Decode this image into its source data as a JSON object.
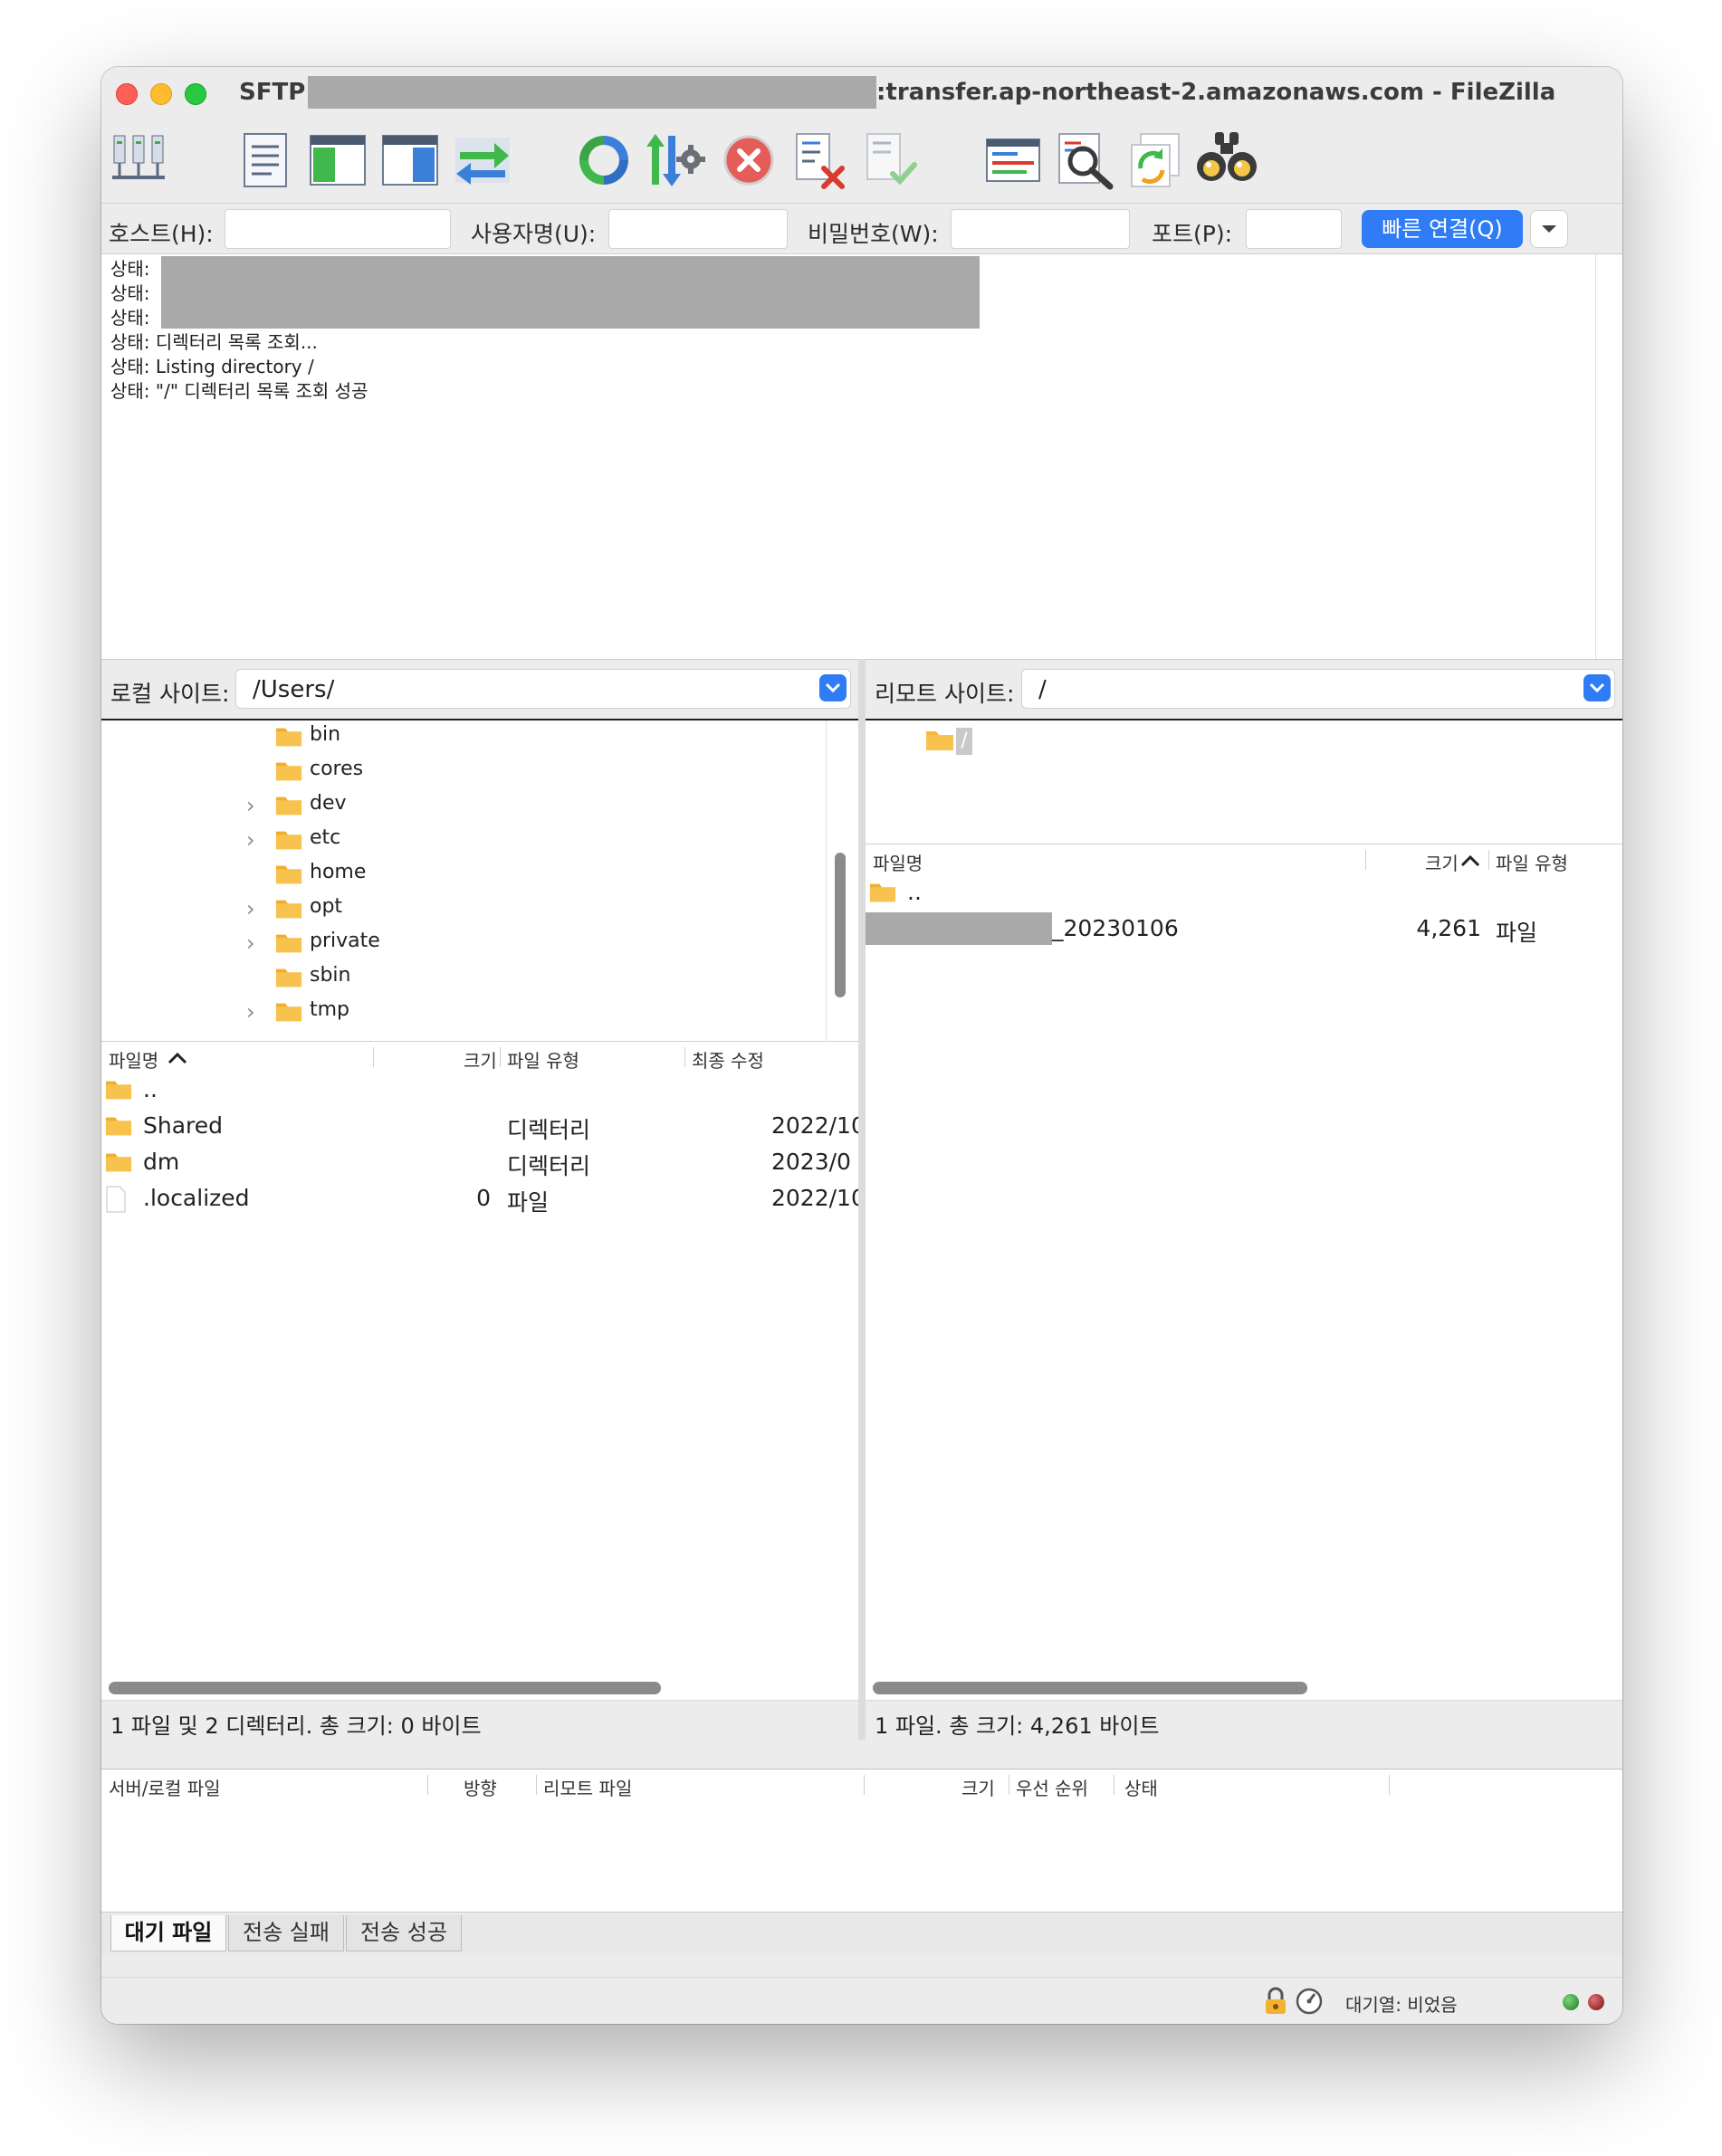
{
  "window": {
    "protocol": "SFTP",
    "host_title": ":transfer.ap-northeast-2.amazonaws.com - FileZilla"
  },
  "toolbar": {
    "buttons": [
      {
        "name": "site-manager-icon"
      },
      {
        "name": "message-log-toggle-icon"
      },
      {
        "name": "local-tree-toggle-icon"
      },
      {
        "name": "remote-tree-toggle-icon"
      },
      {
        "name": "transfer-queue-toggle-icon"
      },
      {
        "name": "refresh-icon"
      },
      {
        "name": "process-queue-icon"
      },
      {
        "name": "cancel-operation-icon"
      },
      {
        "name": "disconnect-icon"
      },
      {
        "name": "reconnect-icon"
      },
      {
        "name": "directory-filter-icon"
      },
      {
        "name": "directory-compare-icon"
      },
      {
        "name": "sync-browse-icon"
      },
      {
        "name": "search-files-icon"
      }
    ]
  },
  "quickconnect": {
    "host_label": "호스트(H):",
    "user_label": "사용자명(U):",
    "pass_label": "비밀번호(W):",
    "port_label": "포트(P):",
    "host_value": "",
    "user_value": "",
    "pass_value": "",
    "port_value": "",
    "connect_button": "빠른 연결(Q)"
  },
  "log": {
    "lines": [
      {
        "prefix": "상태:",
        "text": ""
      },
      {
        "prefix": "상태:",
        "text": ""
      },
      {
        "prefix": "상태:",
        "text": ""
      },
      {
        "prefix": "상태:",
        "text": "디렉터리 목록 조회..."
      },
      {
        "prefix": "상태:",
        "text": "Listing directory /"
      },
      {
        "prefix": "상태:",
        "text": "\"/\" 디렉터리 목록 조회 성공"
      }
    ]
  },
  "local": {
    "site_label": "로컬 사이트:",
    "path": "/Users/",
    "tree": [
      {
        "name": "bin",
        "expandable": false
      },
      {
        "name": "cores",
        "expandable": false
      },
      {
        "name": "dev",
        "expandable": true
      },
      {
        "name": "etc",
        "expandable": true
      },
      {
        "name": "home",
        "expandable": false
      },
      {
        "name": "opt",
        "expandable": true
      },
      {
        "name": "private",
        "expandable": true
      },
      {
        "name": "sbin",
        "expandable": false
      },
      {
        "name": "tmp",
        "expandable": true
      }
    ],
    "columns": {
      "name": "파일명",
      "size": "크기",
      "type": "파일 유형",
      "modified": "최종 수정"
    },
    "files": [
      {
        "name": "..",
        "size": "",
        "type": "",
        "modified": "",
        "kind": "folder"
      },
      {
        "name": "Shared",
        "size": "",
        "type": "디렉터리",
        "modified": "2022/10",
        "kind": "folder"
      },
      {
        "name": "dm",
        "size": "",
        "type": "디렉터리",
        "modified": "2023/0",
        "kind": "folder"
      },
      {
        "name": ".localized",
        "size": "0",
        "type": "파일",
        "modified": "2022/10",
        "kind": "file"
      }
    ],
    "status": "1 파일 및 2 디렉터리. 총 크기: 0 바이트"
  },
  "remote": {
    "site_label": "리모트 사이트:",
    "path": "/",
    "tree_root": "/",
    "columns": {
      "name": "파일명",
      "size": "크기",
      "type": "파일 유형"
    },
    "files": [
      {
        "name": "..",
        "size": "",
        "type": "",
        "kind": "folder"
      },
      {
        "name": "_20230106",
        "size": "4,261",
        "type": "파일",
        "kind": "file-redacted"
      }
    ],
    "status": "1 파일. 총 크기: 4,261 바이트"
  },
  "queue": {
    "columns": {
      "server_local": "서버/로컬 파일",
      "direction": "방향",
      "remote_file": "리모트 파일",
      "size": "크기",
      "priority": "우선 순위",
      "status": "상태"
    },
    "tabs": [
      "대기 파일",
      "전송 실패",
      "전송 성공"
    ],
    "status": "대기열: 비었음"
  },
  "colors": {
    "accent": "#2f7cf6",
    "folder": "#f6b93b",
    "redaction": "#a9a9a9"
  }
}
